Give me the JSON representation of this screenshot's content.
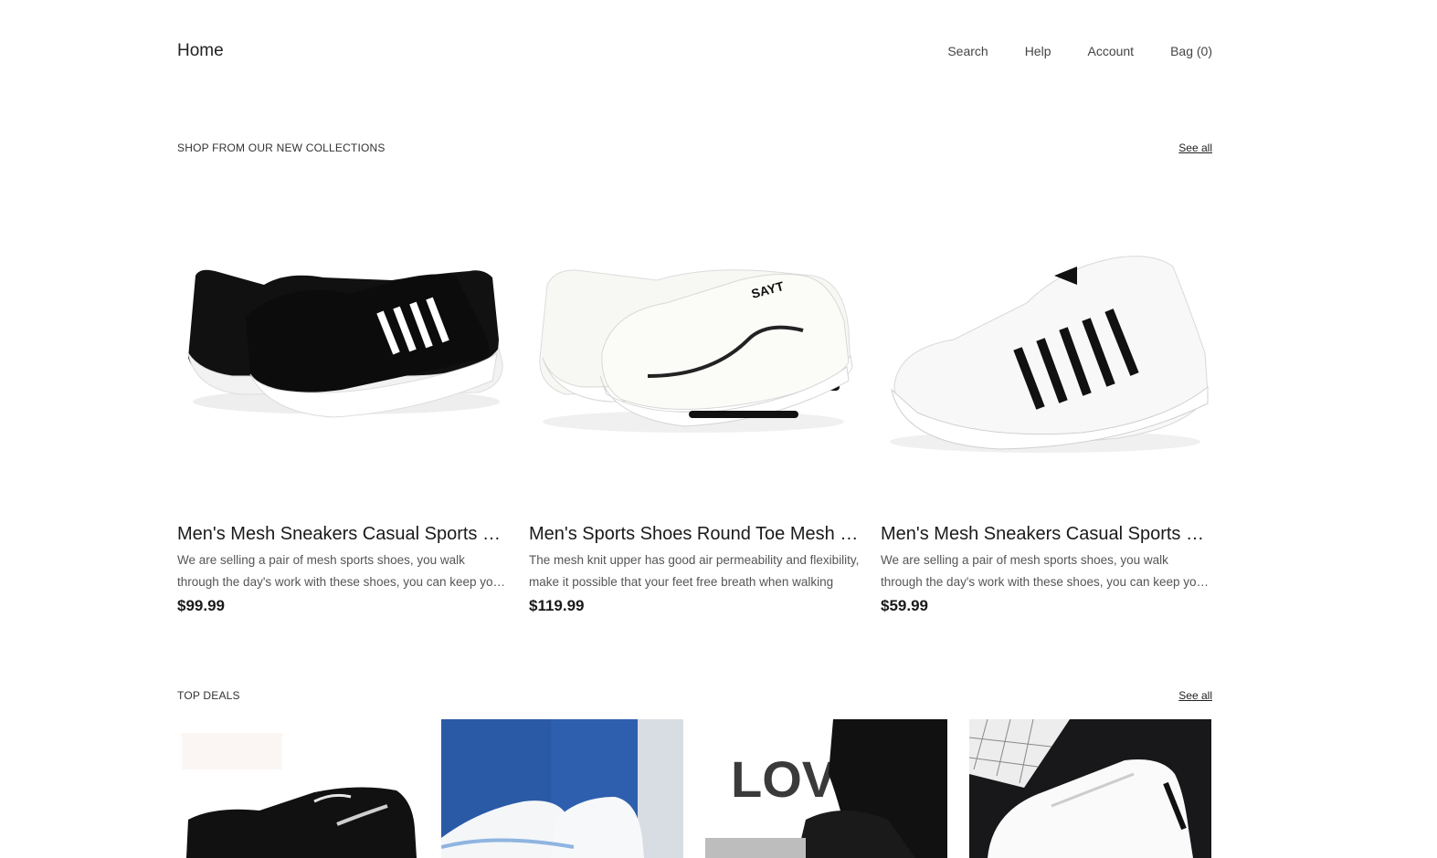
{
  "header": {
    "home": "Home",
    "nav": [
      "Search",
      "Help",
      "Account",
      "Bag (0)"
    ]
  },
  "collections": {
    "title": "SHOP FROM OUR NEW COLLECTIONS",
    "see_all": "See all",
    "products": [
      {
        "title": "Men's Mesh Sneakers Casual Sports Shoes",
        "description": "We are selling a pair of mesh sports shoes, you walk through the day's work with these shoes, you can keep your feet comfortable all day long",
        "price": "$99.99",
        "image": "black-sneaker-image"
      },
      {
        "title": "Men's Sports Shoes Round Toe Mesh Sneakers",
        "description": "The mesh knit upper has good air permeability and flexibility, make it possible that your feet free breath when walking",
        "price": "$119.99",
        "image": "white-sneaker-image"
      },
      {
        "title": "Men's Mesh Sneakers Casual Sports Shoes",
        "description": "We are selling a pair of mesh sports shoes, you walk through the day's work with these shoes, you can keep your feet comfortable all day long",
        "price": "$59.99",
        "image": "white-striped-sneaker-image"
      }
    ]
  },
  "top_deals": {
    "title": "TOP DEALS",
    "see_all": "See all",
    "items": [
      {
        "image": "black-sneaker-deal-image"
      },
      {
        "image": "white-sneakers-blue-background-image"
      },
      {
        "image": "black-sneaker-love-poster-image",
        "poster_text": "LOVE"
      },
      {
        "image": "white-leather-sneaker-image"
      }
    ]
  }
}
